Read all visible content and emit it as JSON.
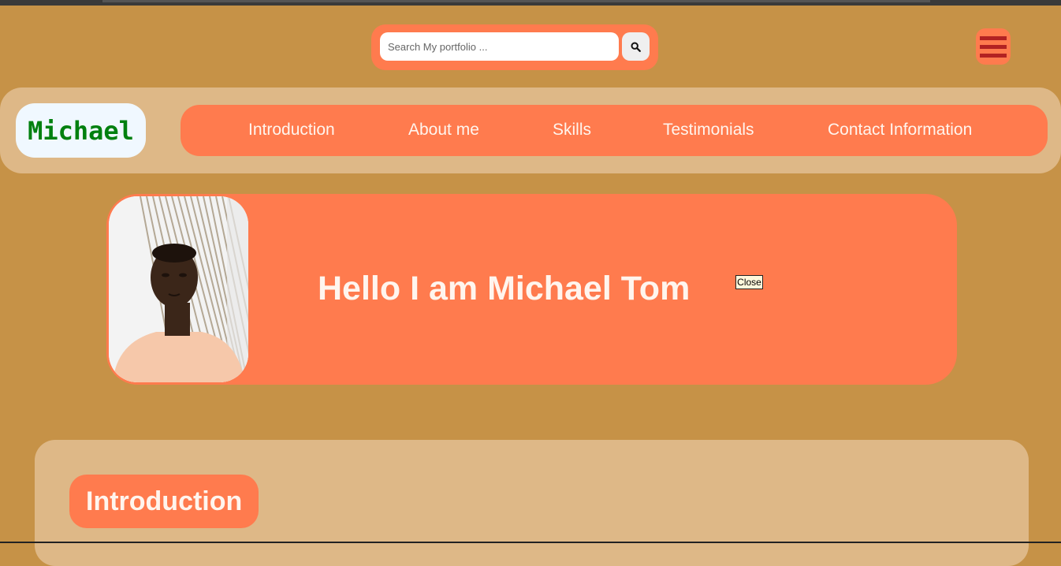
{
  "colors": {
    "page_background": "#c69247",
    "accent": "#ff7b4e",
    "panel": "#deb887",
    "logo_text": "#00800f",
    "light_text": "#fff5ee",
    "menu_bars": "#b22222"
  },
  "header": {
    "search": {
      "placeholder": "Search My portfolio ...",
      "value": "",
      "button_icon": "search-icon"
    },
    "menu_icon": "hamburger-menu-icon"
  },
  "nav": {
    "logo": "Michael",
    "links": [
      {
        "label": "Introduction"
      },
      {
        "label": "About me"
      },
      {
        "label": "Skills"
      },
      {
        "label": "Testimonials"
      },
      {
        "label": "Contact Information"
      }
    ]
  },
  "hero": {
    "title": "Hello I am Michael Tom",
    "close_label": "Close",
    "photo": "portrait-photo"
  },
  "intro_section": {
    "heading": "Introduction"
  }
}
